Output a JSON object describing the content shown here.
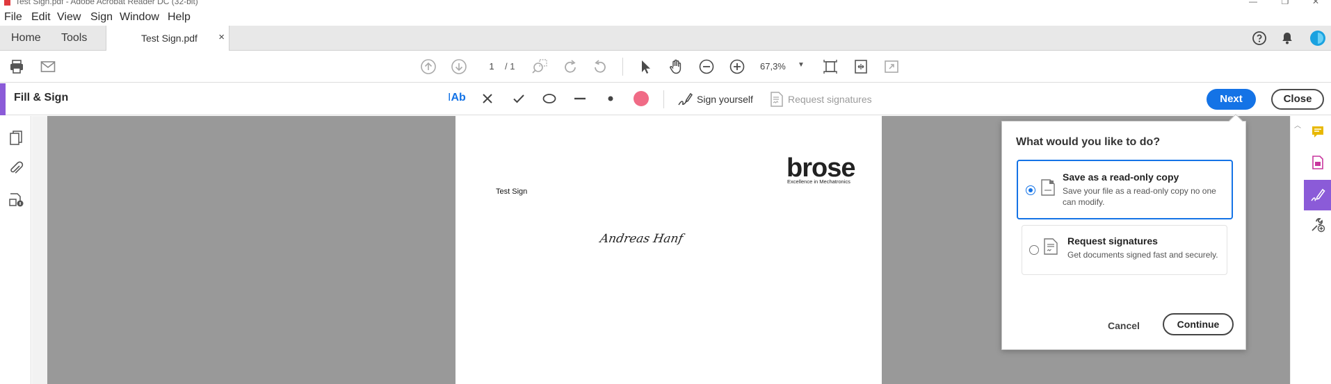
{
  "window": {
    "title": "Test Sign.pdf - Adobe Acrobat Reader DC (32-bit)"
  },
  "menu": {
    "items": [
      "File",
      "Edit",
      "View",
      "Sign",
      "Window",
      "Help"
    ]
  },
  "tabs": {
    "home": "Home",
    "tools": "Tools",
    "document": "Test Sign.pdf",
    "close": "×"
  },
  "toolbar": {
    "page_current": "1",
    "page_total": "/ 1",
    "zoom": "67,3%"
  },
  "fill_sign": {
    "title": "Fill & Sign",
    "text_tool": "Ab",
    "sign_yourself": "Sign yourself",
    "request_signatures": "Request signatures",
    "next": "Next",
    "close": "Close",
    "color_dot": "#f06b86",
    "accent": "#8b5bd8"
  },
  "document": {
    "heading": "Test Sign",
    "logo": "brose",
    "logo_tagline": "Excellence in Mechatronics",
    "signature": "Andreas Hanf"
  },
  "dialog": {
    "question": "What would you like to do?",
    "options": [
      {
        "title": "Save as a read-only copy",
        "description": "Save your file as a read-only copy no one can modify.",
        "selected": true
      },
      {
        "title": "Request signatures",
        "description": "Get documents signed fast and securely.",
        "selected": false
      }
    ],
    "cancel": "Cancel",
    "continue": "Continue"
  },
  "colors": {
    "primary_blue": "#1473e6",
    "doc_background": "#999999"
  }
}
